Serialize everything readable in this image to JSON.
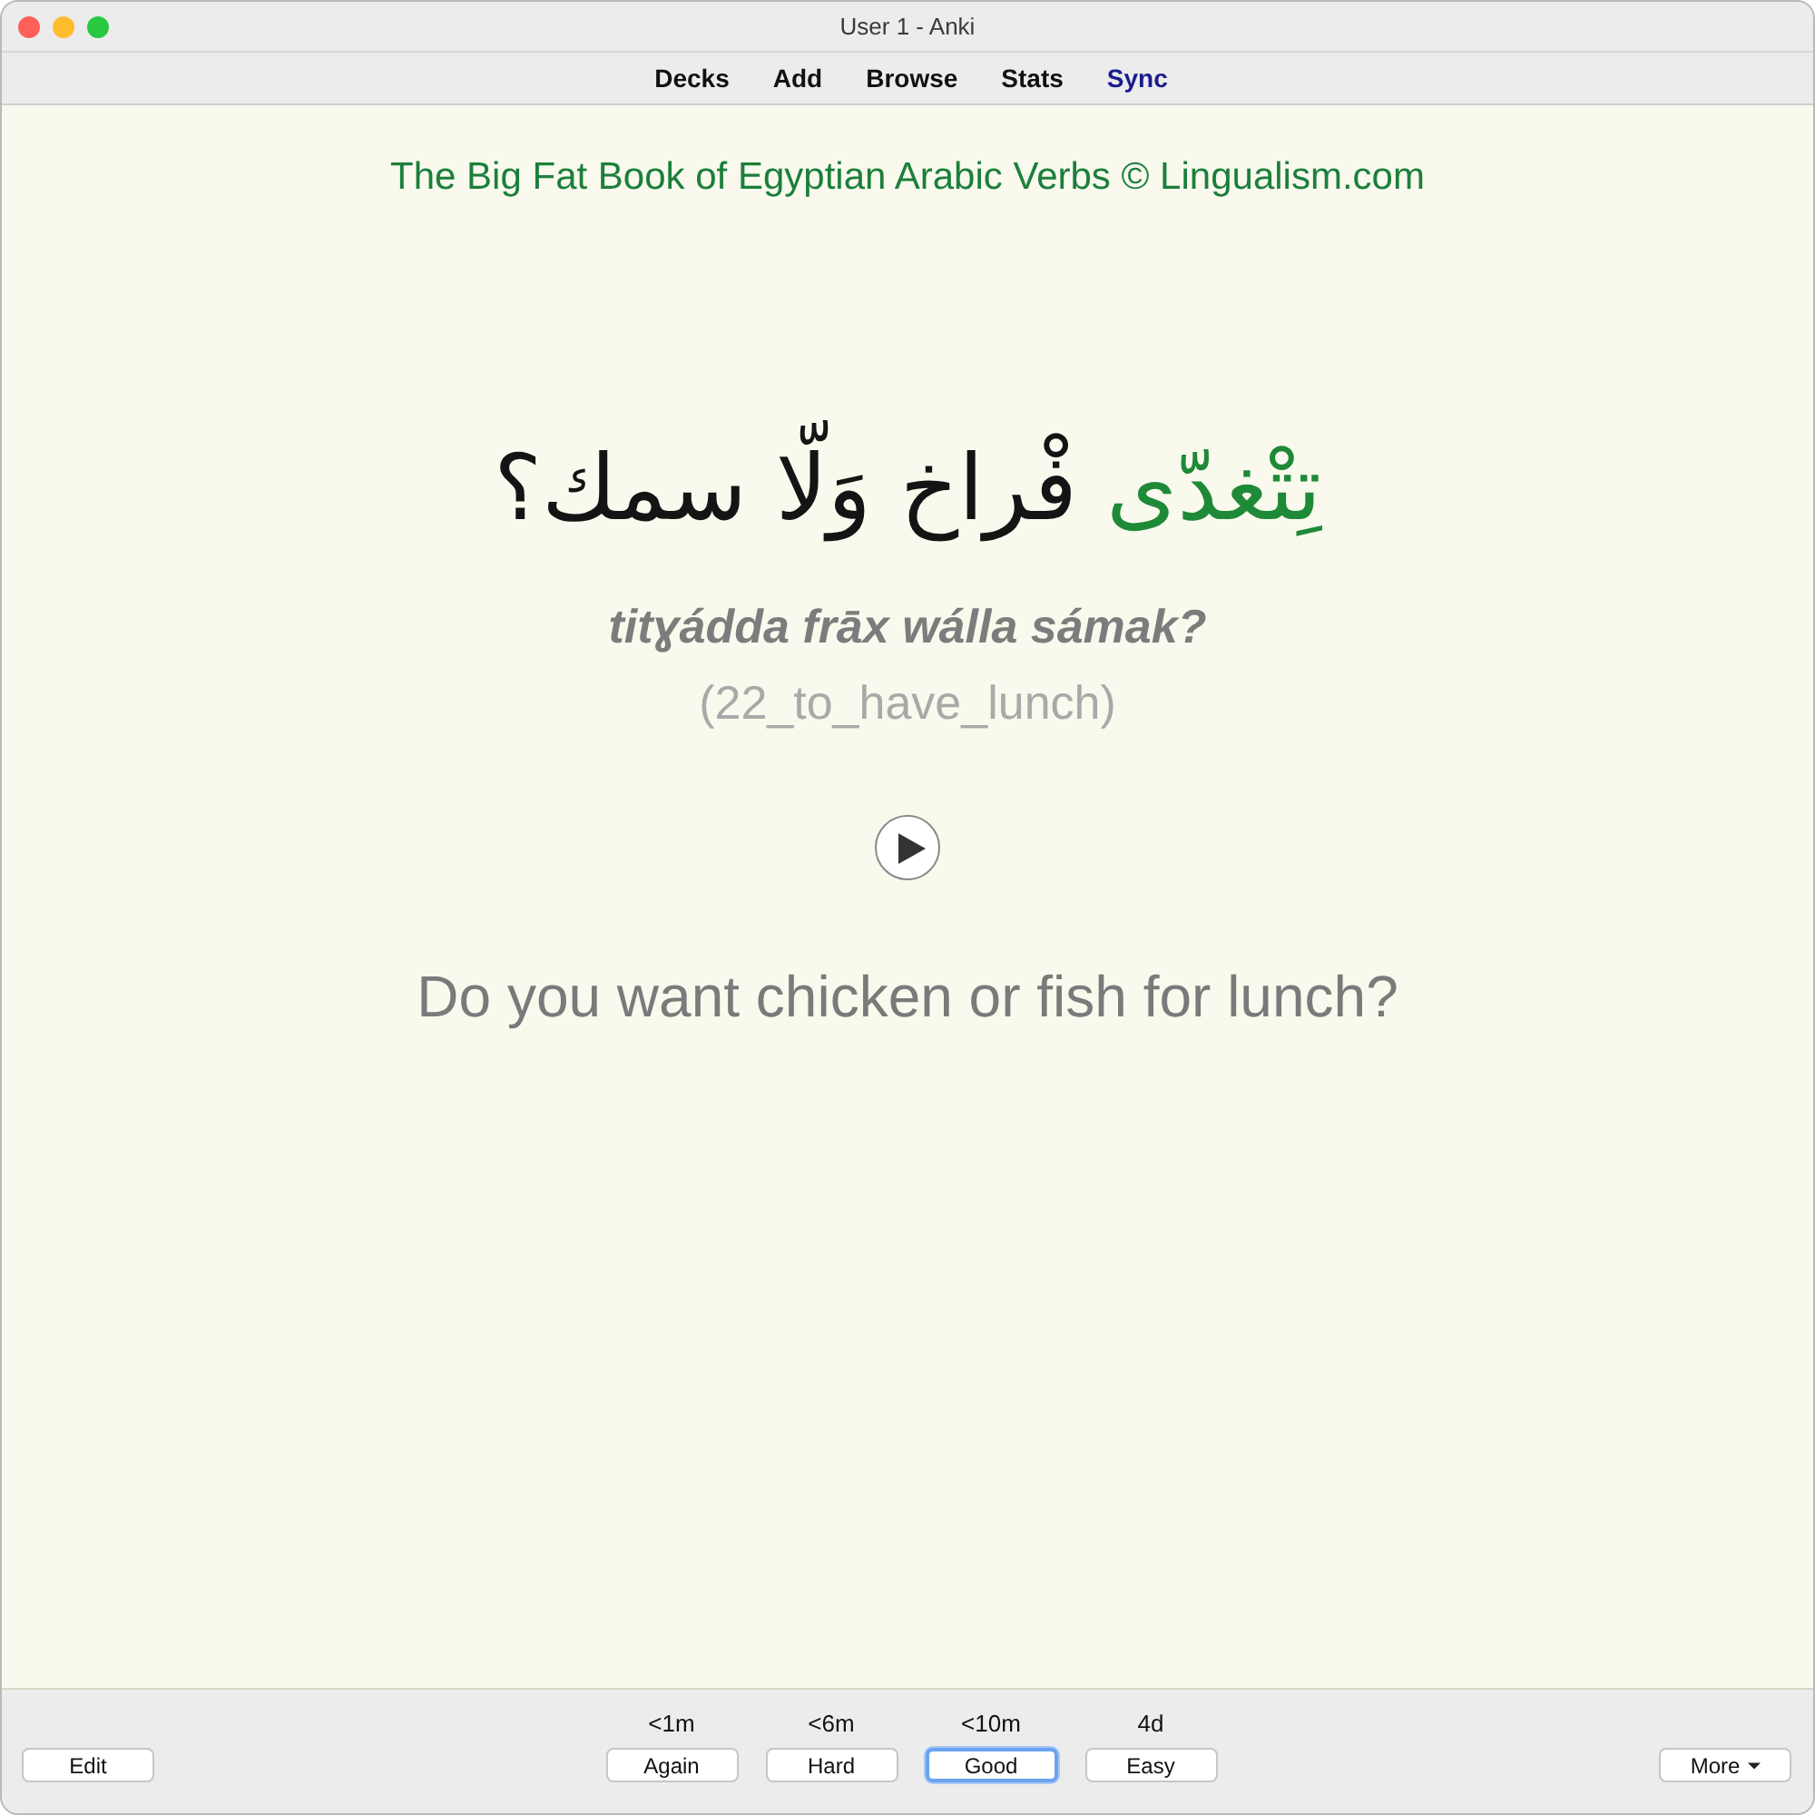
{
  "window": {
    "title": "User 1 - Anki"
  },
  "toolbar": {
    "items": [
      {
        "label": "Decks",
        "highlighted": false
      },
      {
        "label": "Add",
        "highlighted": false
      },
      {
        "label": "Browse",
        "highlighted": false
      },
      {
        "label": "Stats",
        "highlighted": false
      },
      {
        "label": "Sync",
        "highlighted": true
      }
    ]
  },
  "card": {
    "source": "The Big Fat Book of Egyptian Arabic Verbs © Lingualism.com",
    "arabic": {
      "highlighted": "تِتْغدّى",
      "rest": "فْراخ وَلّا سمك؟"
    },
    "transliteration": "titɣádda frāx wálla sámak?",
    "note": "(22_to_have_lunch)",
    "translation": "Do you want chicken or fish for lunch?"
  },
  "bottom_bar": {
    "edit": "Edit",
    "answers": [
      {
        "interval": "<1m",
        "label": "Again",
        "selected": false
      },
      {
        "interval": "<6m",
        "label": "Hard",
        "selected": false
      },
      {
        "interval": "<10m",
        "label": "Good",
        "selected": true
      },
      {
        "interval": "4d",
        "label": "Easy",
        "selected": false
      }
    ],
    "more": "More"
  }
}
